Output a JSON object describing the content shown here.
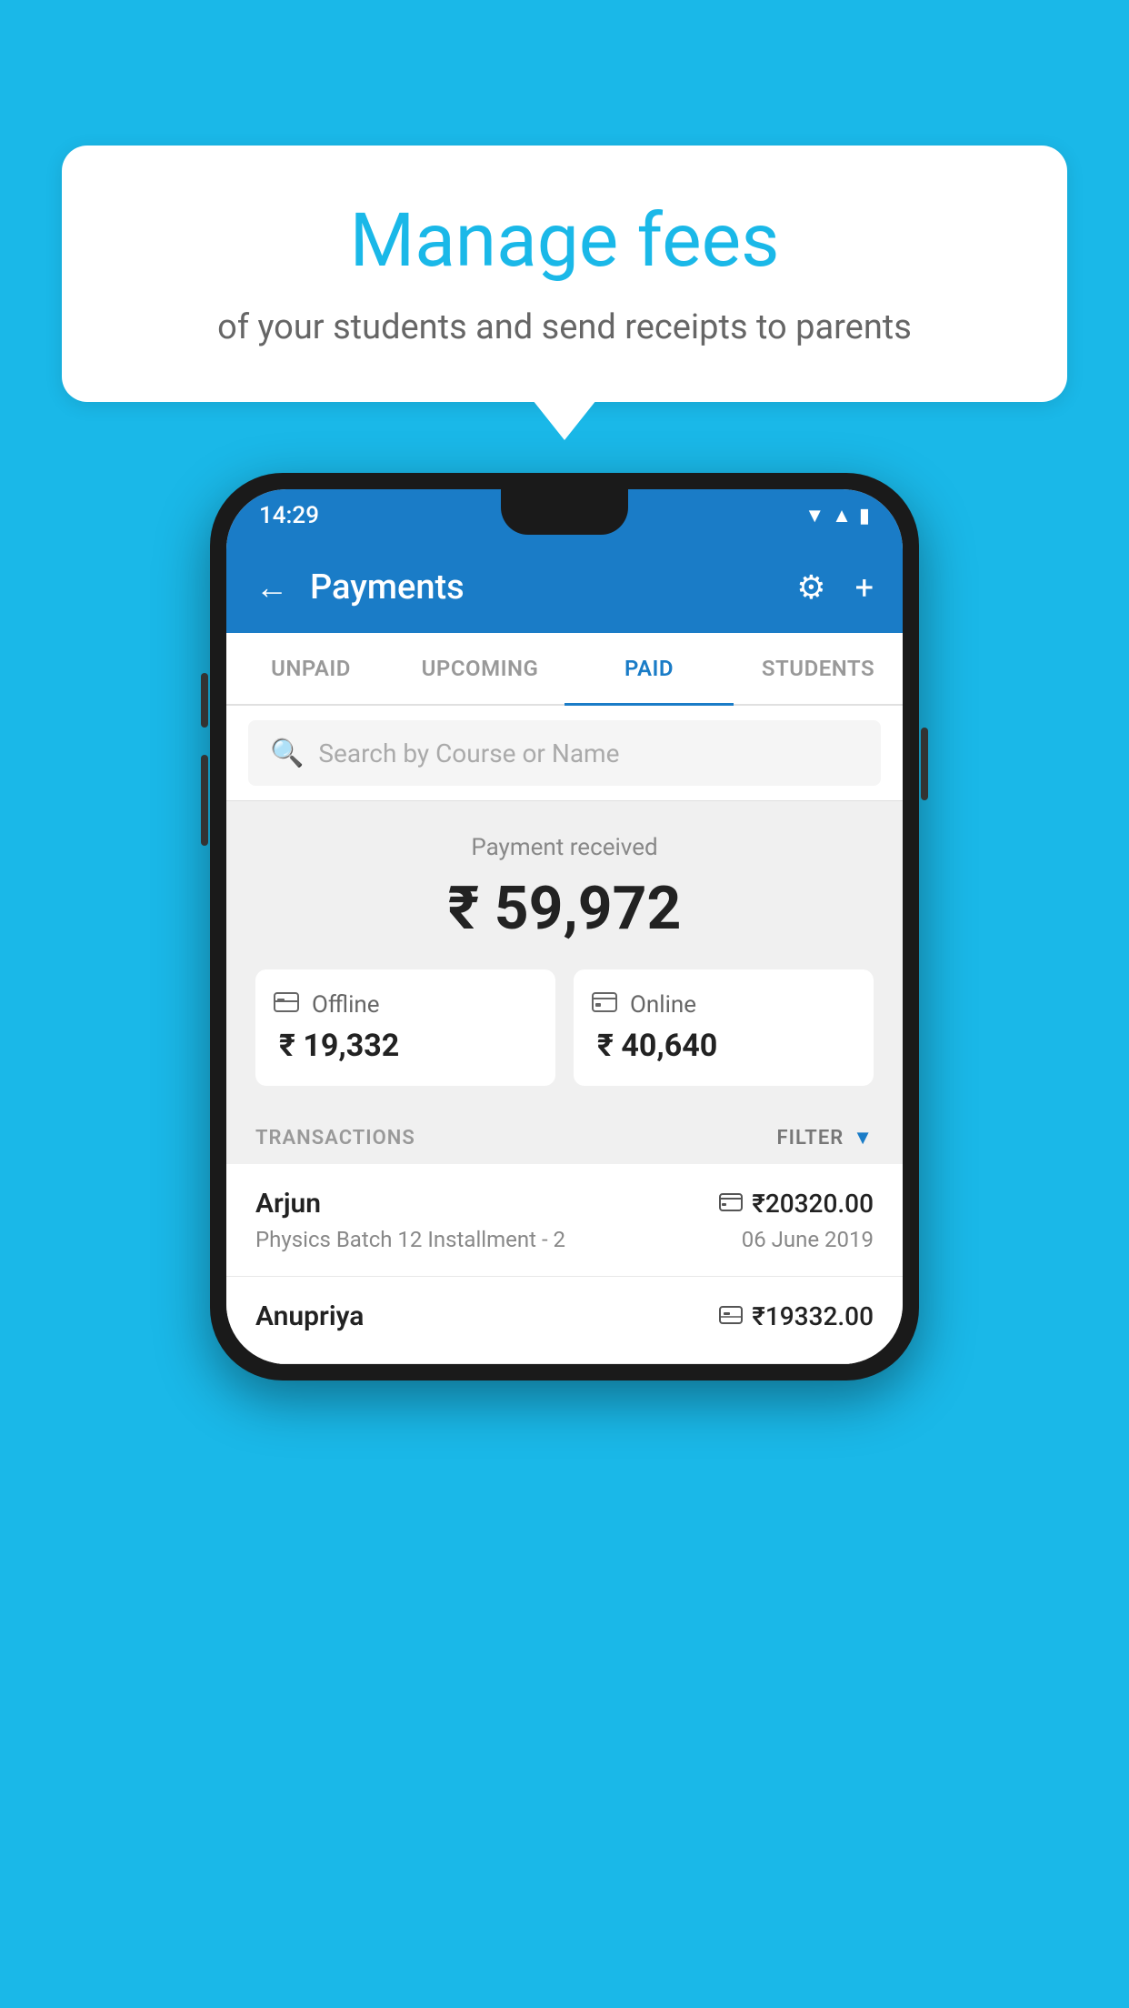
{
  "page": {
    "background_color": "#1ab8e8"
  },
  "speech_bubble": {
    "title": "Manage fees",
    "subtitle": "of your students and send receipts to parents"
  },
  "status_bar": {
    "time": "14:29",
    "wifi": "▼",
    "signal": "▲",
    "battery": "▮"
  },
  "app_bar": {
    "title": "Payments",
    "back_icon": "←",
    "settings_icon": "⚙",
    "add_icon": "+"
  },
  "tabs": [
    {
      "label": "UNPAID",
      "active": false
    },
    {
      "label": "UPCOMING",
      "active": false
    },
    {
      "label": "PAID",
      "active": true
    },
    {
      "label": "STUDENTS",
      "active": false
    }
  ],
  "search": {
    "placeholder": "Search by Course or Name"
  },
  "payment_summary": {
    "label": "Payment received",
    "amount": "₹ 59,972",
    "offline_label": "Offline",
    "offline_amount": "₹ 19,332",
    "online_label": "Online",
    "online_amount": "₹ 40,640"
  },
  "transactions": {
    "header_label": "TRANSACTIONS",
    "filter_label": "FILTER",
    "rows": [
      {
        "name": "Arjun",
        "course": "Physics Batch 12 Installment - 2",
        "amount": "₹20320.00",
        "date": "06 June 2019",
        "payment_type": "online"
      },
      {
        "name": "Anupriya",
        "course": "",
        "amount": "₹19332.00",
        "date": "",
        "payment_type": "offline"
      }
    ]
  }
}
